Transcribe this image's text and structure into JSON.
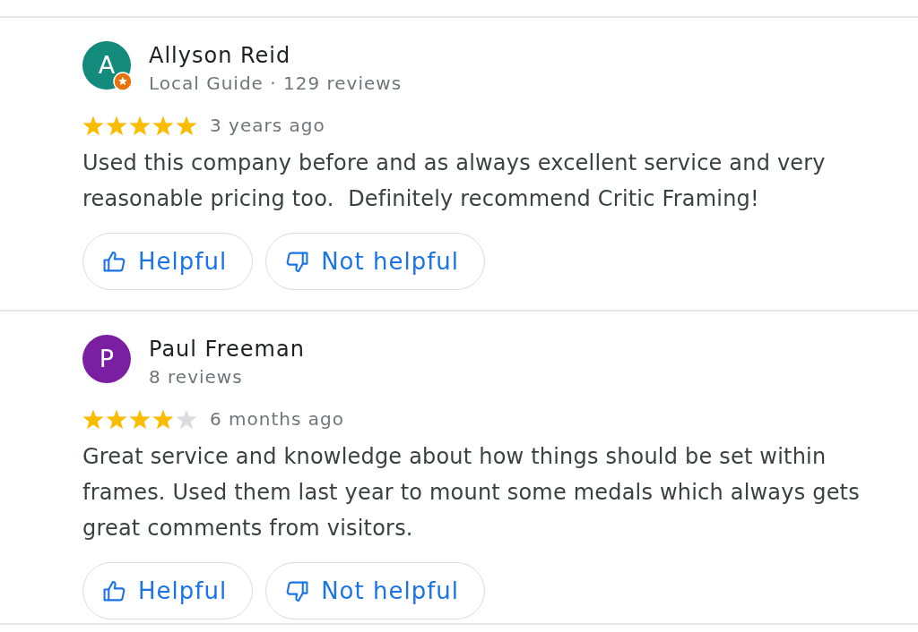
{
  "reviews": [
    {
      "author": {
        "initial": "A",
        "name": "Allyson Reid",
        "color": "#128a7c",
        "local_guide": true
      },
      "meta": "Local Guide · 129 reviews",
      "stars": 5,
      "time": "3 years ago",
      "text": "Used this company before and as always excellent service and very reasonable pricing too.  Definitely recommend Critic Framing!",
      "actions": [
        {
          "kind": "up",
          "label": "Helpful"
        },
        {
          "kind": "down",
          "label": "Not helpful"
        }
      ]
    },
    {
      "author": {
        "initial": "P",
        "name": "Paul Freeman",
        "color": "#7b1fa2",
        "local_guide": false
      },
      "meta": "8 reviews",
      "stars": 4,
      "time": "6 months ago",
      "text": "Great service and knowledge about how things should be set within frames. Used them last year to mount some medals which always gets great comments from visitors.",
      "actions": [
        {
          "kind": "up",
          "label": "Helpful"
        },
        {
          "kind": "down",
          "label": "Not helpful"
        }
      ]
    }
  ]
}
